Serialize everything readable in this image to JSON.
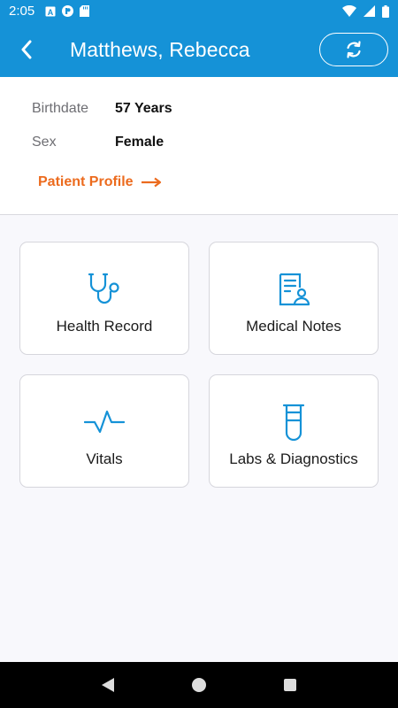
{
  "status_bar": {
    "time": "2:05",
    "icons_left": [
      "text-a-icon",
      "circle-p-icon",
      "sd-card-icon"
    ],
    "icons_right": [
      "wifi-icon",
      "cell-signal-icon",
      "battery-icon"
    ]
  },
  "app_bar": {
    "title": "Matthews, Rebecca",
    "back_icon": "chevron-left-icon",
    "refresh_icon": "refresh-icon",
    "color": "#1592d7"
  },
  "patient": {
    "birthdate_label": "Birthdate",
    "birthdate_value": "57 Years",
    "sex_label": "Sex",
    "sex_value": "Female",
    "profile_link": "Patient Profile",
    "link_color": "#ec6b1e"
  },
  "tiles": [
    {
      "label": "Health Record",
      "icon": "stethoscope-icon"
    },
    {
      "label": "Medical Notes",
      "icon": "medical-notes-icon"
    },
    {
      "label": "Vitals",
      "icon": "heartbeat-icon"
    },
    {
      "label": "Labs & Diagnostics",
      "icon": "test-tube-icon"
    }
  ],
  "nav_bar": {
    "buttons": [
      "back-triangle-icon",
      "home-circle-icon",
      "recents-square-icon"
    ]
  }
}
